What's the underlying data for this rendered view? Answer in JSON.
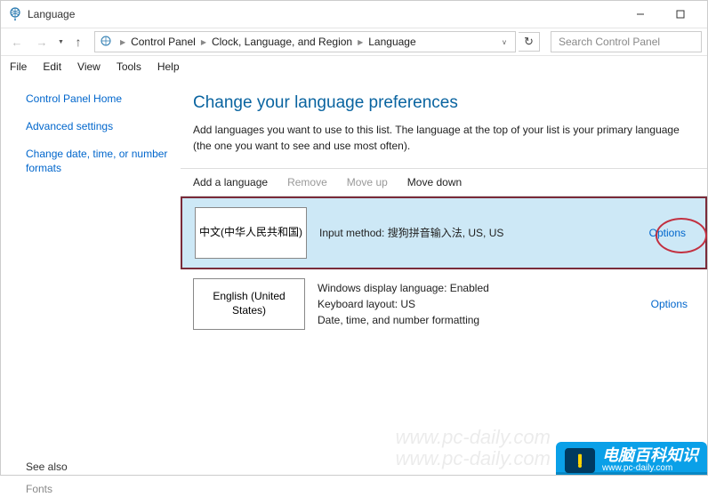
{
  "window": {
    "title": "Language"
  },
  "breadcrumbs": {
    "a": "Control Panel",
    "b": "Clock, Language, and Region",
    "c": "Language"
  },
  "search": {
    "placeholder": "Search Control Panel"
  },
  "menu": {
    "file": "File",
    "edit": "Edit",
    "view": "View",
    "tools": "Tools",
    "help": "Help"
  },
  "sidebar": {
    "home": "Control Panel Home",
    "advanced": "Advanced settings",
    "datetime": "Change date, time, or number formats",
    "seealso_label": "See also",
    "fonts": "Fonts"
  },
  "main": {
    "heading": "Change your language preferences",
    "desc": "Add languages you want to use to this list. The language at the top of your list is your primary language (the one you want to see and use most often)."
  },
  "toolbar": {
    "add": "Add a language",
    "remove": "Remove",
    "moveup": "Move up",
    "movedown": "Move down"
  },
  "langs": {
    "row1": {
      "name": "中文(中华人民共和国)",
      "detail": "Input method: 搜狗拼音输入法, US, US",
      "options": "Options"
    },
    "row2": {
      "name": "English (United States)",
      "detail1": "Windows display language: Enabled",
      "detail2": "Keyboard layout: US",
      "detail3": "Date, time, and number formatting",
      "options": "Options"
    }
  },
  "watermark": {
    "url1": "www.pc-daily.com",
    "url2": "www.pc-daily.com",
    "badge_text": "电脑百科知识",
    "badge_url": "www.pc-daily.com"
  }
}
